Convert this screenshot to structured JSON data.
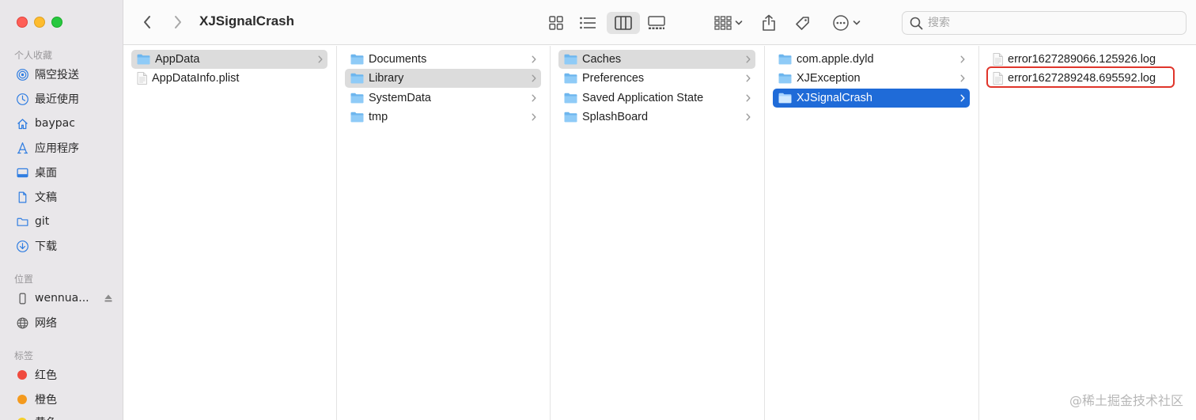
{
  "window": {
    "title": "XJSignalCrash"
  },
  "sidebar": {
    "favorites_header": "个人收藏",
    "favorites": [
      {
        "label": "隔空投送",
        "icon": "airdrop-icon"
      },
      {
        "label": "最近使用",
        "icon": "clock-icon"
      },
      {
        "label": "baypac",
        "icon": "home-icon"
      },
      {
        "label": "应用程序",
        "icon": "applications-icon"
      },
      {
        "label": "桌面",
        "icon": "desktop-icon"
      },
      {
        "label": "文稿",
        "icon": "document-icon"
      },
      {
        "label": "git",
        "icon": "folder-icon"
      },
      {
        "label": "下载",
        "icon": "download-icon"
      }
    ],
    "locations_header": "位置",
    "locations": [
      {
        "label": "wennua...",
        "icon": "phone-icon"
      },
      {
        "label": "网络",
        "icon": "network-icon"
      }
    ],
    "tags_header": "标签",
    "tags": [
      {
        "label": "红色",
        "color": "#f04a3e"
      },
      {
        "label": "橙色",
        "color": "#f49a1e"
      },
      {
        "label": "黄色",
        "color": "#f5cf2c"
      }
    ]
  },
  "toolbar": {
    "search_placeholder": "搜索",
    "active_view": "columns"
  },
  "columns": [
    {
      "items": [
        {
          "name": "AppData",
          "kind": "folder",
          "selected": "gray",
          "has_children": true
        },
        {
          "name": "AppDataInfo.plist",
          "kind": "file",
          "has_children": false
        }
      ]
    },
    {
      "items": [
        {
          "name": "Documents",
          "kind": "folder",
          "has_children": true
        },
        {
          "name": "Library",
          "kind": "folder",
          "selected": "gray",
          "has_children": true
        },
        {
          "name": "SystemData",
          "kind": "folder",
          "has_children": true
        },
        {
          "name": "tmp",
          "kind": "folder",
          "has_children": true
        }
      ]
    },
    {
      "items": [
        {
          "name": "Caches",
          "kind": "folder",
          "selected": "gray",
          "has_children": true
        },
        {
          "name": "Preferences",
          "kind": "folder",
          "has_children": true
        },
        {
          "name": "Saved Application State",
          "kind": "folder",
          "has_children": true
        },
        {
          "name": "SplashBoard",
          "kind": "folder",
          "has_children": true
        }
      ]
    },
    {
      "items": [
        {
          "name": "com.apple.dyld",
          "kind": "folder",
          "has_children": true
        },
        {
          "name": "XJException",
          "kind": "folder",
          "has_children": true
        },
        {
          "name": "XJSignalCrash",
          "kind": "folder",
          "selected": "blue",
          "has_children": true
        }
      ]
    },
    {
      "items": [
        {
          "name": "error1627289066.125926.log",
          "kind": "file",
          "has_children": false
        },
        {
          "name": "error1627289248.695592.log",
          "kind": "file",
          "has_children": false,
          "highlighted": true
        }
      ]
    }
  ],
  "watermark": "@稀土掘金技术社区"
}
